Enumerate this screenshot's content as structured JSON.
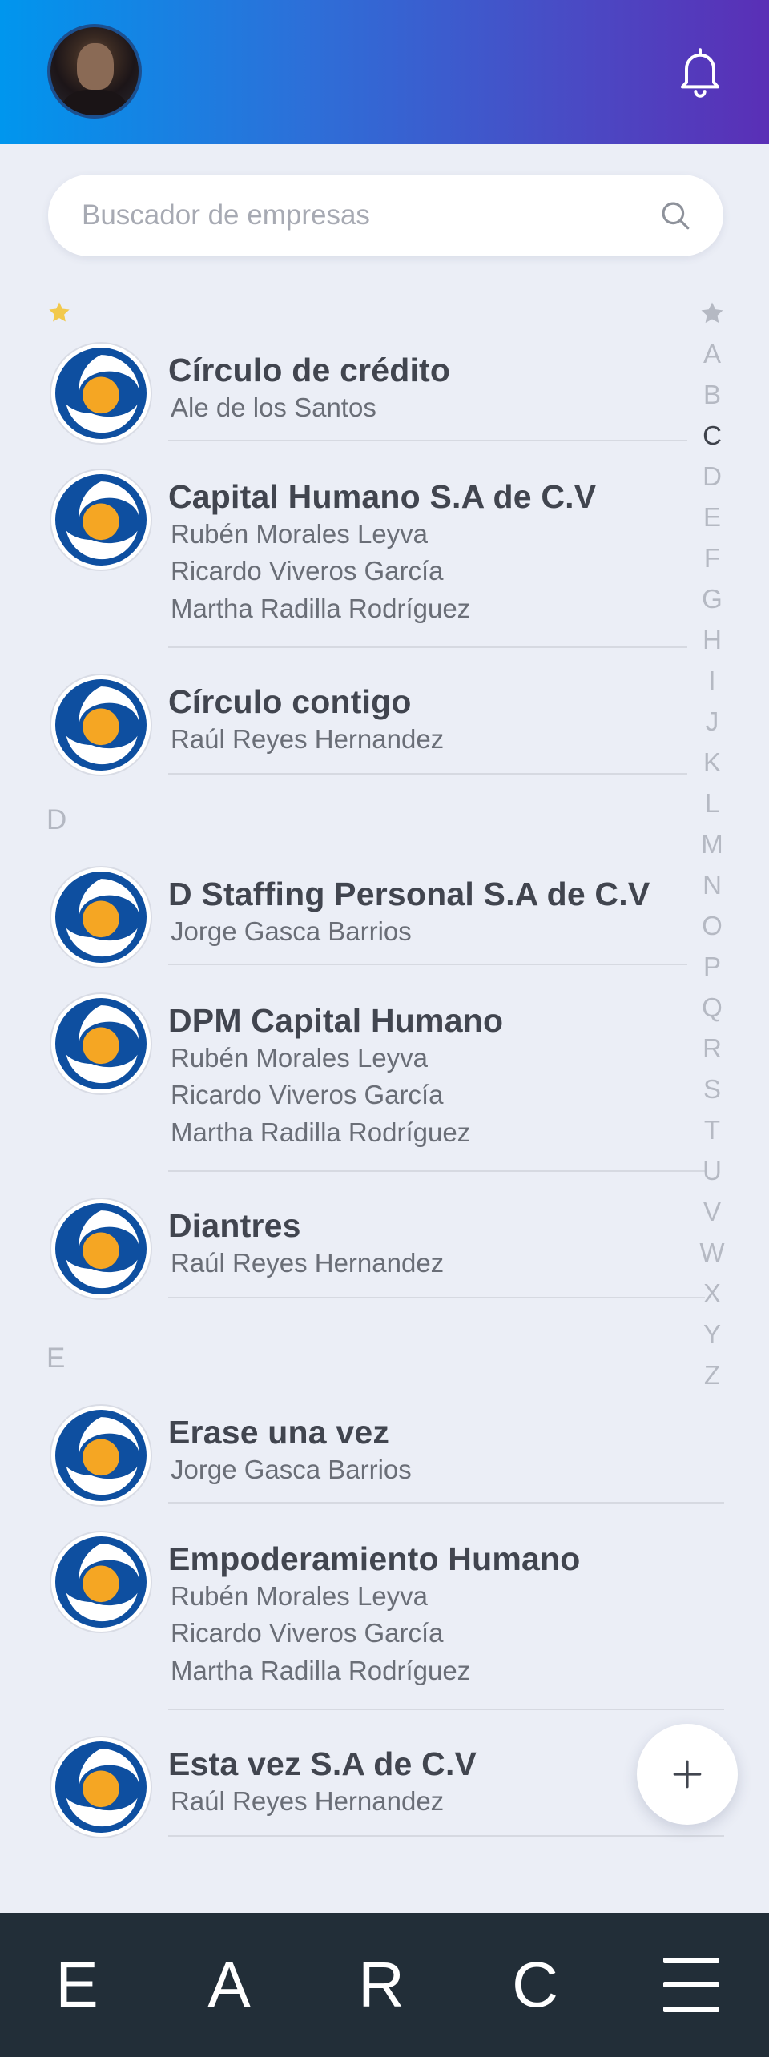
{
  "header": {
    "avatar_icon": "user-avatar",
    "bell_icon": "bell-icon"
  },
  "search": {
    "placeholder": "Buscador de empresas",
    "value": ""
  },
  "sections": [
    {
      "marker": "star",
      "letter": ""
    },
    {
      "marker": "letter",
      "letter": "D"
    },
    {
      "marker": "letter",
      "letter": "E"
    }
  ],
  "companies": [
    {
      "title": "Círculo de crédito",
      "contacts": [
        "Ale de los Santos"
      ]
    },
    {
      "title": "Capital Humano S.A de C.V",
      "contacts": [
        "Rubén Morales Leyva",
        "Ricardo Viveros García",
        "Martha Radilla Rodríguez"
      ]
    },
    {
      "title": "Círculo contigo",
      "contacts": [
        "Raúl Reyes Hernandez"
      ]
    },
    {
      "title": "D Staffing Personal S.A de C.V",
      "contacts": [
        "Jorge Gasca Barrios"
      ]
    },
    {
      "title": "DPM Capital Humano",
      "contacts": [
        "Rubén Morales Leyva",
        "Ricardo Viveros García",
        "Martha Radilla Rodríguez"
      ]
    },
    {
      "title": "Diantres",
      "contacts": [
        "Raúl Reyes Hernandez"
      ]
    },
    {
      "title": "Erase una vez",
      "contacts": [
        "Jorge Gasca Barrios"
      ]
    },
    {
      "title": "Empoderamiento Humano",
      "contacts": [
        "Rubén Morales Leyva",
        "Ricardo Viveros García",
        "Martha Radilla Rodríguez"
      ]
    },
    {
      "title": "Esta vez S.A de C.V",
      "contacts": [
        "Raúl Reyes Hernandez"
      ]
    }
  ],
  "alphabet_index": {
    "active": "C",
    "letters": [
      "A",
      "B",
      "C",
      "D",
      "E",
      "F",
      "G",
      "H",
      "I",
      "J",
      "K",
      "L",
      "M",
      "N",
      "O",
      "P",
      "Q",
      "R",
      "S",
      "T",
      "U",
      "V",
      "W",
      "X",
      "Y",
      "Z"
    ]
  },
  "fab": {
    "icon": "plus-icon"
  },
  "bottom_nav": {
    "items": [
      "E",
      "A",
      "R",
      "C"
    ],
    "menu_icon": "hamburger-menu-icon"
  },
  "colors": {
    "header_gradient_start": "#0096EE",
    "header_gradient_end": "#5A2FB6",
    "star": "#F2C94C",
    "logo_blue": "#0E4FA0",
    "logo_orange": "#F5A623",
    "nav_bg": "#222E38",
    "page_bg": "#EBEEF6"
  }
}
